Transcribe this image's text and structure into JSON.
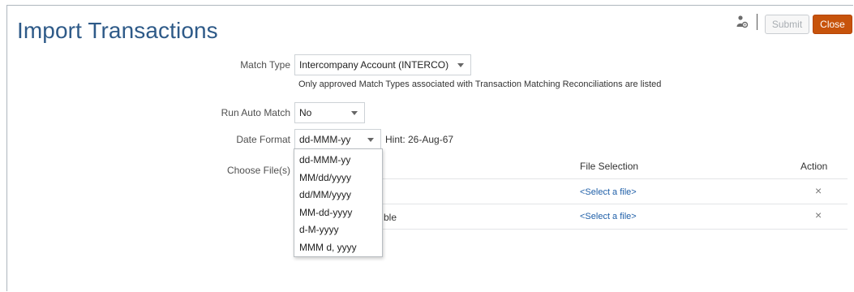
{
  "page": {
    "title": "Import Transactions"
  },
  "toolbar": {
    "icon": "user-settings-icon",
    "submit_label": "Submit",
    "close_label": "Close",
    "close_color": "#c7530b"
  },
  "form": {
    "match_type": {
      "label": "Match Type",
      "value": "Intercompany Account (INTERCO)",
      "note": "Only approved Match Types associated with Transaction Matching Reconciliations are listed"
    },
    "run_auto_match": {
      "label": "Run Auto Match",
      "value": "No"
    },
    "date_format": {
      "label": "Date Format",
      "value": "dd-MMM-yy",
      "hint": "Hint: 26-Aug-67",
      "options": [
        "dd-MMM-yy",
        "MM/dd/yyyy",
        "dd/MM/yyyy",
        "MM-dd-yyyy",
        "d-M-yyyy",
        "MMM d, yyyy"
      ]
    },
    "choose_files": {
      "label": "Choose File(s)",
      "columns": {
        "file_selection": "File Selection",
        "action": "Action"
      },
      "rows": [
        {
          "name_fragment": "",
          "file_link": "<Select a file>",
          "action_icon": "×"
        },
        {
          "name_fragment": "ble",
          "file_link": "<Select a file>",
          "action_icon": "×"
        }
      ]
    }
  }
}
